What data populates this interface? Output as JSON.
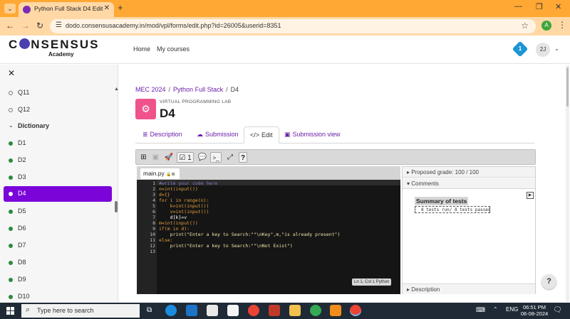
{
  "browser": {
    "tab_title": "Python Full Stack D4 Edit",
    "url": "dodo.consensusacademy.in/mod/vpl/forms/edit.php?id=26005&userid=8351",
    "profile_initial": "A"
  },
  "site": {
    "logo_pre": "C",
    "logo_post": "NSENSUS",
    "logo_sub": "Academy",
    "nav": [
      "Home",
      "My courses"
    ],
    "notification_count": "1",
    "user_initials": "2J"
  },
  "drawer": {
    "items": [
      {
        "label": "Q11",
        "type": "open"
      },
      {
        "label": "Q12",
        "type": "open"
      },
      {
        "label": "Dictionary",
        "type": "section"
      },
      {
        "label": "D1",
        "type": "done"
      },
      {
        "label": "D2",
        "type": "done"
      },
      {
        "label": "D3",
        "type": "done"
      },
      {
        "label": "D4",
        "type": "done",
        "active": true
      },
      {
        "label": "D5",
        "type": "done"
      },
      {
        "label": "D6",
        "type": "done"
      },
      {
        "label": "D7",
        "type": "done"
      },
      {
        "label": "D8",
        "type": "done"
      },
      {
        "label": "D9",
        "type": "done"
      },
      {
        "label": "D10",
        "type": "done"
      }
    ]
  },
  "page": {
    "breadcrumb": [
      "MEC 2024",
      "Python Full Stack",
      "D4"
    ],
    "activity_kind": "VIRTUAL PROGRAMMING LAB",
    "activity_title": "D4",
    "tabs": [
      {
        "label": "Description",
        "icon": "≣"
      },
      {
        "label": "Submission",
        "icon": "☁"
      },
      {
        "label": "Edit",
        "icon": "</>"
      },
      {
        "label": "Submission view",
        "icon": "▣"
      }
    ]
  },
  "toolbar": {
    "files_count": "1",
    "console_label": ">_",
    "help_label": "?"
  },
  "editor": {
    "filename": "main.py",
    "lines": [
      "#write your code here",
      "n=int(input())",
      "d={}",
      "for i in range(n):",
      "    k=int(input())",
      "    v=int(input())",
      "    d[k]=v",
      "m=int(input())",
      "if(m in d):",
      "    print(\"Enter a key to Search:\"\"\\nKey\",m,\"is already present\")",
      "else:",
      "    print(\"Enter a key to Search:\"\"\\nNot Exist\")",
      ""
    ],
    "cursor_status": "Ln 1, Col 1 Python"
  },
  "results": {
    "proposed_grade": "Proposed grade: 100 / 100",
    "comments_label": "Comments",
    "summary_title": "Summary of tests",
    "tests_passed": "8 tests run/ 8 tests passed",
    "description_label": "Description"
  },
  "taskbar": {
    "search_placeholder": "Type here to search",
    "language": "ENG",
    "time": "06:51 PM",
    "date": "06-08-2024"
  }
}
